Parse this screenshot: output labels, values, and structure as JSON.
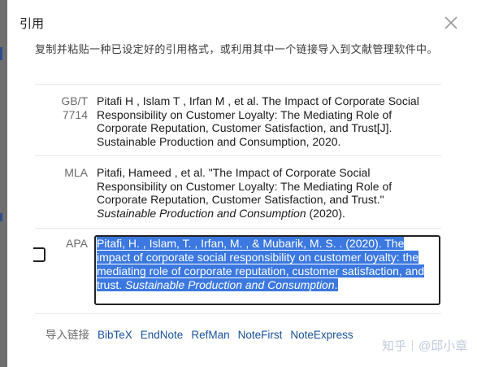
{
  "dialog": {
    "title": "引用",
    "description": "复制并粘贴一种已设定好的引用格式，或利用其中一个链接导入到文献管理软件中。"
  },
  "citations": [
    {
      "style": "GB/T 7714",
      "text": "Pitafi H , Islam T , Irfan M , et al. The Impact of Corporate Social Responsibility on Customer Loyalty: The Mediating Role of Corporate Reputation, Customer Satisfaction, and Trust[J]. Sustainable Production and Consumption, 2020."
    },
    {
      "style": "MLA",
      "text_before": "Pitafi, Hameed , et al. \"The Impact of Corporate Social Responsibility on Customer Loyalty: The Mediating Role of Corporate Reputation, Customer Satisfaction, and Trust.\" ",
      "journal": "Sustainable Production and Consumption",
      "text_after": " (2020)."
    },
    {
      "style": "APA",
      "text_before": "Pitafi, H. , Islam, T. , Irfan, M. , & Mubarik, M. S. . (2020). The impact of corporate social responsibility on customer loyalty: the mediating role of corporate reputation, customer satisfaction, and trust. ",
      "journal": "Sustainable Production and Consumption",
      "text_after": "."
    }
  ],
  "import": {
    "label": "导入链接",
    "links": [
      "BibTeX",
      "EndNote",
      "RefMan",
      "NoteFirst",
      "NoteExpress"
    ]
  },
  "watermark": {
    "brand": "知乎",
    "author": "@邱小章"
  },
  "colors": {
    "selection": "#3b78e0",
    "link": "#175199",
    "backdrop": "#7d7d7d"
  },
  "icons": {
    "close": "close-icon"
  }
}
